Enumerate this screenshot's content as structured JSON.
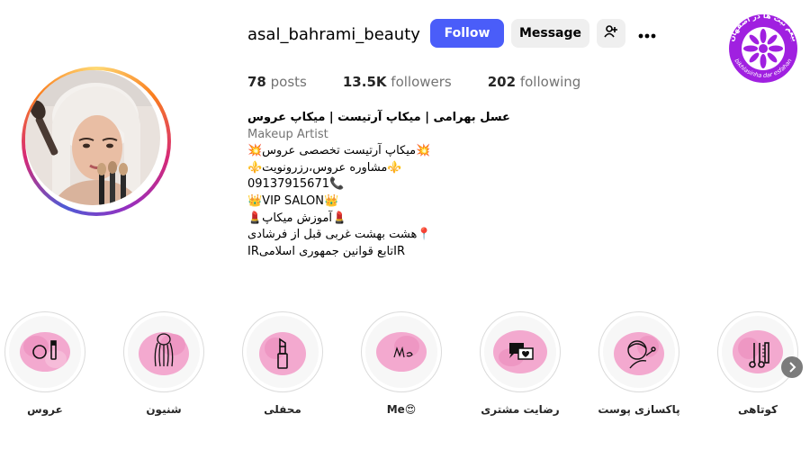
{
  "profile": {
    "username": "asal_bahrami_beauty",
    "follow_label": "Follow",
    "message_label": "Message",
    "stats": {
      "posts_count": "78",
      "posts_label": "posts",
      "followers_count": "13.5K",
      "followers_label": "followers",
      "following_count": "202",
      "following_label": "following"
    },
    "bio": {
      "full_name": "عسل بهرامی | میکاپ آرتیست | میکاپ عروس",
      "category": "Makeup Artist",
      "lines": [
        "💥میکاپ آرتیست تخصصی عروس💥",
        "⚜️مشاوره عروس،رزرونویت⚜️",
        "09137915671📞",
        "👑VIP SALON👑",
        "💄آموزش میکاپ💄",
        "📍هشت بهشت غربی قبل از فرشادی",
        "IRتابع قوانین جمهوری اسلامیIR"
      ]
    }
  },
  "badge": {
    "text_top": "بیغم نیت ها در اصفهان",
    "text_bottom": "bikhlasinha dar esfahan"
  },
  "highlights": [
    {
      "label": "کوتاهی",
      "icon": "scissors-comb-icon"
    },
    {
      "label": "پاکسازی پوست",
      "icon": "face-mask-icon"
    },
    {
      "label": "رضایت مشتری",
      "icon": "chat-heart-icon"
    },
    {
      "label": "Me😍",
      "icon": "signature-icon"
    },
    {
      "label": "محفلی",
      "icon": "lipstick-icon"
    },
    {
      "label": "شنیون",
      "icon": "hairstyle-icon"
    },
    {
      "label": "عروس",
      "icon": "makeup-kit-icon"
    }
  ],
  "colors": {
    "follow_button": "#4a5df9",
    "secondary_button": "#efefef",
    "badge_purple": "#9b1fd6",
    "highlight_pink": "#f3a9cf"
  }
}
